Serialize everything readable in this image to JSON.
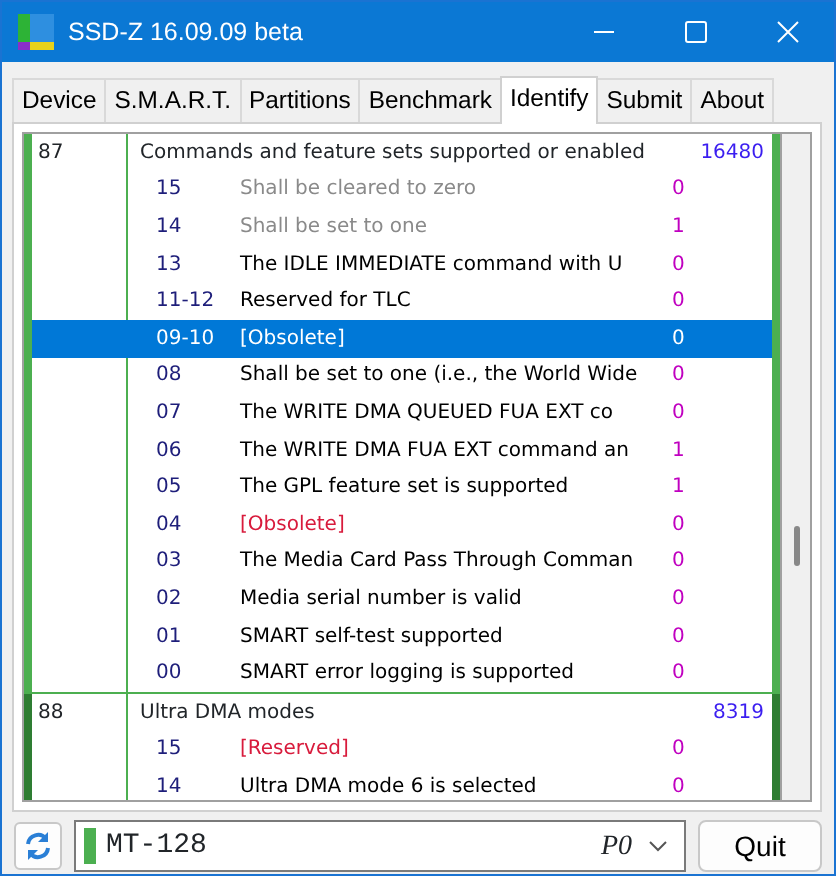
{
  "window": {
    "title": "SSD-Z 16.09.09 beta"
  },
  "tabs": [
    {
      "label": "Device",
      "selected": false
    },
    {
      "label": "S.M.A.R.T.",
      "selected": false
    },
    {
      "label": "Partitions",
      "selected": false
    },
    {
      "label": "Benchmark",
      "selected": false
    },
    {
      "label": "Identify",
      "selected": true
    },
    {
      "label": "Submit",
      "selected": false
    },
    {
      "label": "About",
      "selected": false
    }
  ],
  "identify": {
    "groups": [
      {
        "word": "87",
        "name": "Commands and feature sets supported or enabled",
        "value": "16480",
        "color": "#4caf50",
        "bits": [
          {
            "bit": "15",
            "description": "Shall be cleared to zero",
            "value": "0",
            "kind": "greyed",
            "selected": false
          },
          {
            "bit": "14",
            "description": "Shall be set to one",
            "value": "1",
            "kind": "greyed",
            "selected": false
          },
          {
            "bit": "13",
            "description": "The IDLE IMMEDIATE command with U",
            "value": "0",
            "kind": "normal",
            "selected": false
          },
          {
            "bit": "11-12",
            "description": "Reserved for TLC",
            "value": "0",
            "kind": "normal",
            "selected": false
          },
          {
            "bit": "09-10",
            "description": "[Obsolete]",
            "value": "0",
            "kind": "reserved",
            "selected": true
          },
          {
            "bit": "08",
            "description": "Shall be set to one (i.e., the World Wide",
            "value": "0",
            "kind": "normal",
            "selected": false
          },
          {
            "bit": "07",
            "description": "The WRITE DMA QUEUED FUA EXT co",
            "value": "0",
            "kind": "normal",
            "selected": false
          },
          {
            "bit": "06",
            "description": "The WRITE DMA FUA EXT command an",
            "value": "1",
            "kind": "normal",
            "selected": false
          },
          {
            "bit": "05",
            "description": "The GPL feature set is supported",
            "value": "1",
            "kind": "normal",
            "selected": false
          },
          {
            "bit": "04",
            "description": "[Obsolete]",
            "value": "0",
            "kind": "reserved",
            "selected": false
          },
          {
            "bit": "03",
            "description": "The Media Card Pass Through Comman",
            "value": "0",
            "kind": "normal",
            "selected": false
          },
          {
            "bit": "02",
            "description": "Media serial number is valid",
            "value": "0",
            "kind": "normal",
            "selected": false
          },
          {
            "bit": "01",
            "description": "SMART self-test supported",
            "value": "0",
            "kind": "normal",
            "selected": false
          },
          {
            "bit": "00",
            "description": "SMART error logging is supported",
            "value": "0",
            "kind": "normal",
            "selected": false
          }
        ]
      },
      {
        "word": "88",
        "name": "Ultra DMA modes",
        "value": "8319",
        "color": "#2e7d32",
        "bits": [
          {
            "bit": "15",
            "description": "[Reserved]",
            "value": "0",
            "kind": "reserved",
            "selected": false
          },
          {
            "bit": "14",
            "description": "Ultra DMA mode 6 is selected",
            "value": "0",
            "kind": "normal",
            "selected": false
          }
        ]
      }
    ]
  },
  "device": {
    "model": "MT-128",
    "port": "P0"
  },
  "quit_button": "Quit"
}
